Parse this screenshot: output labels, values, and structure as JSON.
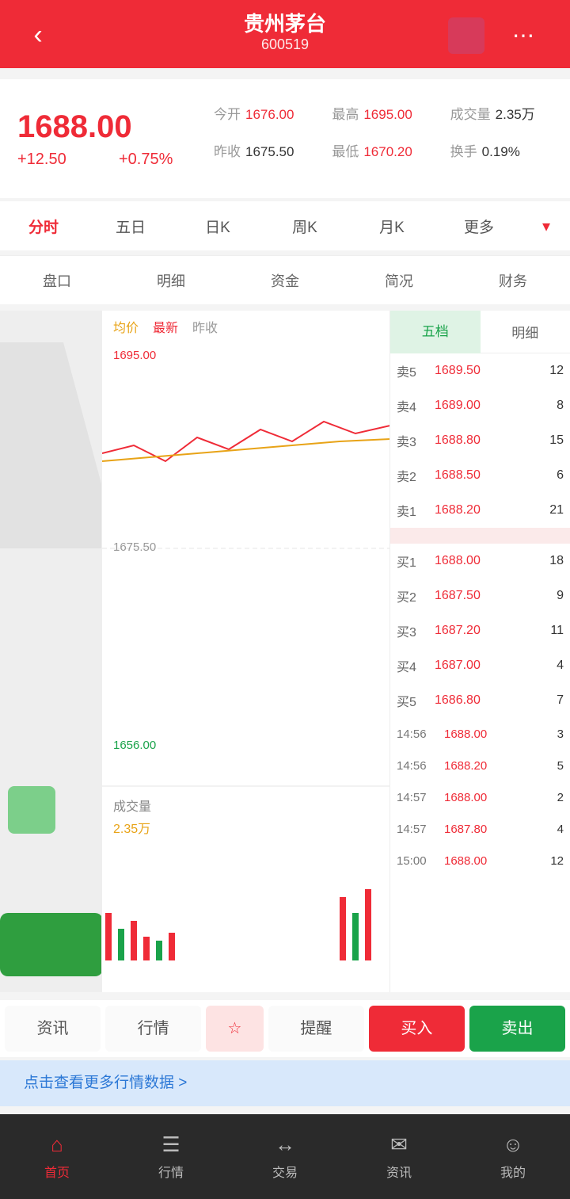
{
  "header": {
    "back_icon": "‹",
    "title": "贵州茅台",
    "subtitle": "600519",
    "menu_icon": "⋯"
  },
  "quote": {
    "price": "1688.00",
    "change": "+12.50",
    "percent": "+0.75%",
    "fields": [
      {
        "k": "今开",
        "v": "1676.00"
      },
      {
        "k": "最高",
        "v": "1695.00"
      },
      {
        "k": "成交量",
        "v": "2.35万"
      },
      {
        "k": "昨收",
        "v": "1675.50"
      },
      {
        "k": "最低",
        "v": "1670.20"
      },
      {
        "k": "换手",
        "v": "0.19%"
      }
    ]
  },
  "period_tabs": [
    "分时",
    "五日",
    "日K",
    "周K",
    "月K",
    "更多"
  ],
  "period_arrow": "▾",
  "sub_tabs": [
    "盘口",
    "明细",
    "资金",
    "简况",
    "财务"
  ],
  "chart": {
    "legend": [
      "均价",
      "最新",
      "昨收"
    ],
    "high": "1695.00",
    "mid": "1675.50",
    "low": "1656.00",
    "vol_title": "成交量",
    "vol_value": "2.35万"
  },
  "book": {
    "tabs": [
      "五档",
      "明细"
    ],
    "asks": [
      {
        "lbl": "卖5",
        "pr": "1689.50",
        "qty": "12"
      },
      {
        "lbl": "卖4",
        "pr": "1689.00",
        "qty": "8"
      },
      {
        "lbl": "卖3",
        "pr": "1688.80",
        "qty": "15"
      },
      {
        "lbl": "卖2",
        "pr": "1688.50",
        "qty": "6"
      },
      {
        "lbl": "卖1",
        "pr": "1688.20",
        "qty": "21"
      }
    ],
    "bids": [
      {
        "lbl": "买1",
        "pr": "1688.00",
        "qty": "18"
      },
      {
        "lbl": "买2",
        "pr": "1687.50",
        "qty": "9"
      },
      {
        "lbl": "买3",
        "pr": "1687.20",
        "qty": "11"
      },
      {
        "lbl": "买4",
        "pr": "1687.00",
        "qty": "4"
      },
      {
        "lbl": "买5",
        "pr": "1686.80",
        "qty": "7"
      }
    ],
    "trades": [
      {
        "t": "14:56",
        "p": "1688.00",
        "n": "3"
      },
      {
        "t": "14:56",
        "p": "1688.20",
        "n": "5"
      },
      {
        "t": "14:57",
        "p": "1688.00",
        "n": "2"
      },
      {
        "t": "14:57",
        "p": "1687.80",
        "n": "4"
      },
      {
        "t": "15:00",
        "p": "1688.00",
        "n": "12"
      }
    ]
  },
  "actions": [
    "资讯",
    "行情",
    "☆",
    "提醒",
    "买入",
    "卖出"
  ],
  "tip": "点击查看更多行情数据 >",
  "nav": [
    {
      "icon": "⌂",
      "label": "首页"
    },
    {
      "icon": "☰",
      "label": "行情"
    },
    {
      "icon": "↔",
      "label": "交易"
    },
    {
      "icon": "✉",
      "label": "资讯"
    },
    {
      "icon": "☺",
      "label": "我的"
    }
  ],
  "colors": {
    "up": "#ef2b37",
    "down": "#1aa34a",
    "brand": "#ef2b37"
  }
}
